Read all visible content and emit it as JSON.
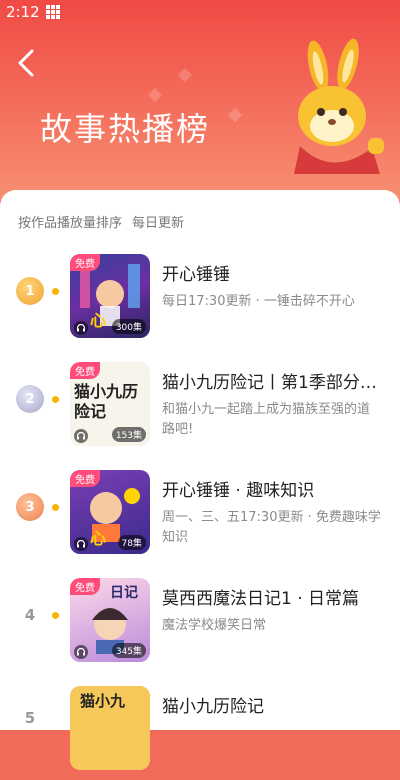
{
  "status_bar": {
    "time": "2:12"
  },
  "header": {
    "title": "故事热播榜"
  },
  "subtitle": {
    "sort_text": "按作品播放量排序",
    "update_text": "每日更新"
  },
  "items": [
    {
      "rank": "1",
      "badge": "免费",
      "cover_text": "心",
      "episodes": "300集",
      "name": "开心锤锤",
      "desc": "每日17:30更新 · 一锤击碎不开心"
    },
    {
      "rank": "2",
      "badge": "免费",
      "cover_text": "猫小九历险记",
      "episodes": "153集",
      "name": "猫小九历险记丨第1季部分…",
      "desc": "和猫小九一起踏上成为猫族至强的道路吧!"
    },
    {
      "rank": "3",
      "badge": "免费",
      "cover_text": "心",
      "episodes": "78集",
      "name": "开心锤锤 · 趣味知识",
      "desc": "周一、三、五17:30更新 · 免费趣味学知识"
    },
    {
      "rank": "4",
      "badge": "免费",
      "cover_text": "日记",
      "episodes": "345集",
      "name": "莫西西魔法日记1 · 日常篇",
      "desc": "魔法学校爆笑日常"
    },
    {
      "rank": "5",
      "badge": "",
      "cover_text": "猫小九",
      "episodes": "",
      "name": "猫小九历险记",
      "desc": ""
    }
  ],
  "colors": {
    "accent": "#f25a4c",
    "gold": "#f5b942",
    "silver": "#b5b5d2",
    "bronze": "#f09060",
    "free_badge": "#ff4d7b"
  }
}
